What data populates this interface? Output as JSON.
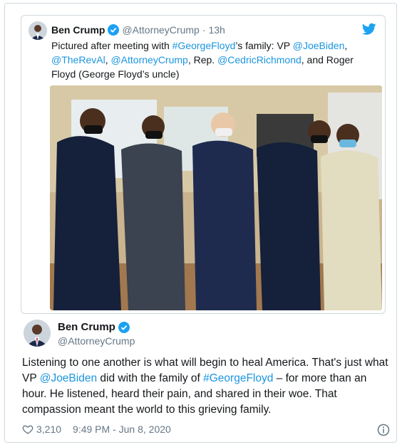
{
  "colors": {
    "link": "#1b95e0",
    "verified": "#1da1f2",
    "muted": "#657786",
    "border": "#cfd9de"
  },
  "quoted_tweet": {
    "name": "Ben Crump",
    "handle": "@AttorneyCrump",
    "separator": "·",
    "time": "13h",
    "text_parts": [
      "Pictured after meeting with ",
      "#GeorgeFloyd",
      "’s family: VP ",
      "@JoeBiden",
      ", ",
      "@TheRevAl",
      ", ",
      "@AttorneyCrump",
      ", Rep. ",
      "@CedricRichmond",
      ", and Roger Floyd (George Floyd’s uncle)"
    ],
    "icons": {
      "avatar": "avatar-photo",
      "verified": "verified-badge-icon",
      "brand": "twitter-bird-icon"
    }
  },
  "tweet": {
    "name": "Ben Crump",
    "handle": "@AttorneyCrump",
    "text_parts": [
      "Listening to one another is what will begin to heal America. That's just what VP ",
      "@JoeBiden",
      " did with the family of ",
      "#GeorgeFloyd",
      " – for more than an hour. He listened, heard their pain, and shared in their woe. That compassion meant the world to this grieving family."
    ],
    "likes": "3,210",
    "timestamp": "9:49 PM - Jun 8, 2020",
    "icons": {
      "like": "heart-icon",
      "info": "info-icon"
    }
  }
}
